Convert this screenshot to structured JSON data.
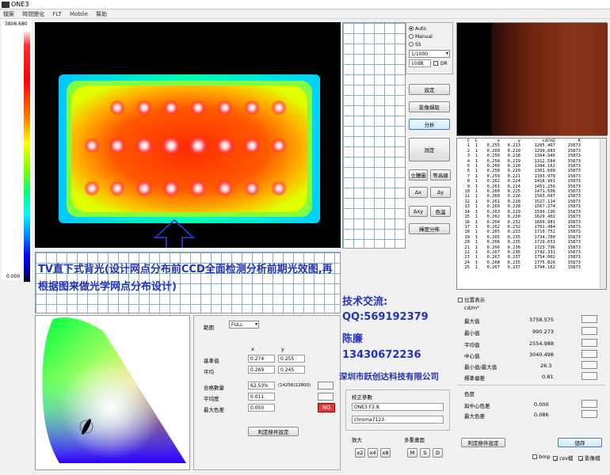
{
  "window": {
    "title": "ONE3"
  },
  "menu": [
    "檔案",
    "時間變化",
    "FLT",
    "Mobile",
    "幫助"
  ],
  "scale": {
    "max": "3806.680",
    "min": "0.000"
  },
  "exposure": {
    "modes": [
      {
        "label": "Auto",
        "selected": true
      },
      {
        "label": "Manual",
        "selected": false
      },
      {
        "label": "SS",
        "selected": false
      }
    ],
    "shutter": "1/1000",
    "nd": "10dB",
    "dr_label": "DR"
  },
  "buttons": {
    "settings": "設定",
    "capture": "影像擷取",
    "analyze": "分析",
    "measure": "測定",
    "stereo": "立體圖",
    "contour": "等高線",
    "delta_x": "Δx",
    "delta_y": "Δy",
    "delta_xy": "Δxy",
    "color": "色溫",
    "lum_dist": "輝度分佈"
  },
  "table": {
    "headers": [
      "C",
      "L",
      "x",
      "y",
      "cd/m2",
      "K"
    ],
    "rows": [
      [
        "1",
        "1",
        "0.255",
        "0.213",
        "1205.467",
        "15873"
      ],
      [
        "2",
        "1",
        "0.260",
        "0.219",
        "1299.883",
        "15873"
      ],
      [
        "3",
        "1",
        "0.256",
        "0.218",
        "1304.946",
        "15873"
      ],
      [
        "4",
        "1",
        "0.258",
        "0.219",
        "1312.584",
        "15873"
      ],
      [
        "5",
        "1",
        "0.260",
        "0.220",
        "1344.162",
        "15873"
      ],
      [
        "6",
        "1",
        "0.258",
        "0.220",
        "1361.660",
        "15873"
      ],
      [
        "7",
        "1",
        "0.259",
        "0.221",
        "1393.979",
        "15873"
      ],
      [
        "8",
        "1",
        "0.262",
        "0.224",
        "1418.991",
        "15873"
      ],
      [
        "9",
        "1",
        "0.261",
        "0.224",
        "1451.256",
        "15873"
      ],
      [
        "10",
        "1",
        "0.260",
        "0.225",
        "1471.508",
        "15873"
      ],
      [
        "11",
        "1",
        "0.260",
        "0.226",
        "1503.087",
        "15873"
      ],
      [
        "12",
        "1",
        "0.261",
        "0.228",
        "1527.114",
        "15873"
      ],
      [
        "13",
        "1",
        "0.260",
        "0.228",
        "1567.274",
        "15873"
      ],
      [
        "14",
        "1",
        "0.263",
        "0.229",
        "1599.196",
        "15873"
      ],
      [
        "15",
        "1",
        "0.262",
        "0.230",
        "1629.402",
        "15873"
      ],
      [
        "16",
        "1",
        "0.264",
        "0.232",
        "1660.981",
        "15873"
      ],
      [
        "17",
        "1",
        "0.262",
        "0.232",
        "1701.484",
        "15873"
      ],
      [
        "18",
        "1",
        "0.265",
        "0.233",
        "1710.752",
        "15873"
      ],
      [
        "19",
        "1",
        "0.265",
        "0.235",
        "1734.780",
        "15873"
      ],
      [
        "20",
        "1",
        "0.266",
        "0.235",
        "1729.631",
        "15873"
      ],
      [
        "21",
        "1",
        "0.266",
        "0.236",
        "1723.796",
        "15873"
      ],
      [
        "22",
        "1",
        "0.267",
        "0.236",
        "1742.331",
        "15873"
      ],
      [
        "23",
        "1",
        "0.267",
        "0.237",
        "1754.002",
        "15873"
      ],
      [
        "24",
        "1",
        "0.268",
        "0.235",
        "1775.826",
        "15873"
      ],
      [
        "25",
        "1",
        "0.267",
        "0.237",
        "1794.162",
        "15873"
      ]
    ]
  },
  "stats": {
    "show_position": "位置表示",
    "unit": "cd/m²",
    "items": [
      {
        "label": "最大值",
        "value": "3758.575"
      },
      {
        "label": "最小值",
        "value": "990.273"
      },
      {
        "label": "平均值",
        "value": "2554.988"
      },
      {
        "label": "中心值",
        "value": "3040.498"
      },
      {
        "label": "最小值/最大值",
        "value": "26.3"
      },
      {
        "label": "標準偏差",
        "value": "0.81"
      }
    ],
    "color_title": "色度",
    "color_items": [
      {
        "label": "與中心色差",
        "value": "0.000"
      },
      {
        "label": "最大色差",
        "value": "0.086"
      }
    ],
    "judge_setting": "判定條件設定",
    "save": "儲存",
    "checks": [
      {
        "label": "bmp",
        "checked": false
      },
      {
        "label": "csv檔",
        "checked": true
      },
      {
        "label": "影像檔",
        "checked": true
      }
    ]
  },
  "judge": {
    "range_label": "範圍",
    "range_value": "FULL",
    "col_x": "x",
    "col_y": "y",
    "rows": [
      {
        "label": "基準值",
        "x": "0.274",
        "y": "0.255"
      },
      {
        "label": "平均",
        "x": "0.269",
        "y": "0.245"
      }
    ],
    "pass_rate_label": "合格數量",
    "pass_rate": "62.53%",
    "pass_count": "(14256/22800)",
    "uniformity_label": "平均度",
    "uniformity": "0.011",
    "max_diff_label": "最大色差",
    "max_diff": "0.050",
    "result": "NG",
    "button": "判定條件設定"
  },
  "calib": {
    "title": "校正參數",
    "lens": "ONE3 F2.8",
    "file": "chroma7123",
    "zoom_label": "放大",
    "zoom": [
      "x2",
      "x4",
      "x8"
    ],
    "multi_label": "多重畫面",
    "multi": [
      "M",
      "S",
      "D"
    ]
  },
  "overlay": {
    "caption": "TV直下式背光(设计网点分布前CCD全面检测分析前期光效图,再根据图来做光学网点分布设计)",
    "contact_title": "技术交流:",
    "qq": "QQ:569192379",
    "name": "陈廉",
    "phone": "13430672236",
    "company": "深圳市跃创达科技有限公司"
  },
  "colors": {
    "accent": "#2332b8",
    "ng": "#e23a3a"
  }
}
